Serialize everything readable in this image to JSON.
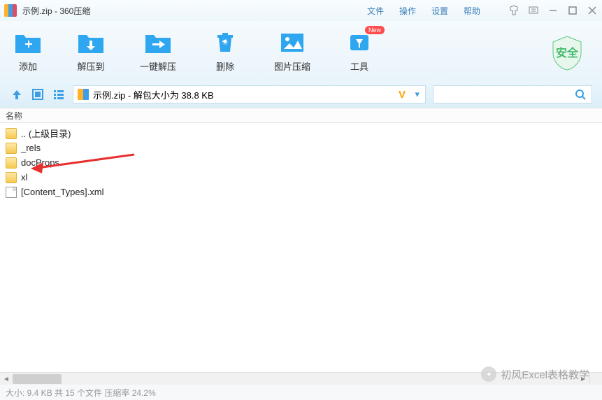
{
  "titlebar": {
    "title": "示例.zip - 360压缩",
    "menu": {
      "file": "文件",
      "operate": "操作",
      "settings": "设置",
      "help": "帮助"
    }
  },
  "toolbar": {
    "add": "添加",
    "extract": "解压到",
    "oneclick": "一键解压",
    "delete": "删除",
    "imgcompress": "图片压缩",
    "tools": "工具",
    "tools_badge": "New",
    "safe": "安全"
  },
  "address": {
    "path": "示例.zip - 解包大小为 38.8 KB",
    "vip": "V"
  },
  "filelist": {
    "header": "名称",
    "rows": [
      {
        "name": ".. (上级目录)",
        "type": "folder"
      },
      {
        "name": "_rels",
        "type": "folder"
      },
      {
        "name": "docProps",
        "type": "folder"
      },
      {
        "name": "xl",
        "type": "folder"
      },
      {
        "name": "[Content_Types].xml",
        "type": "file"
      }
    ]
  },
  "status": "大小: 9.4 KB 共 15 个文件 压缩率 24.2%",
  "watermark": "初风Excel表格教学"
}
